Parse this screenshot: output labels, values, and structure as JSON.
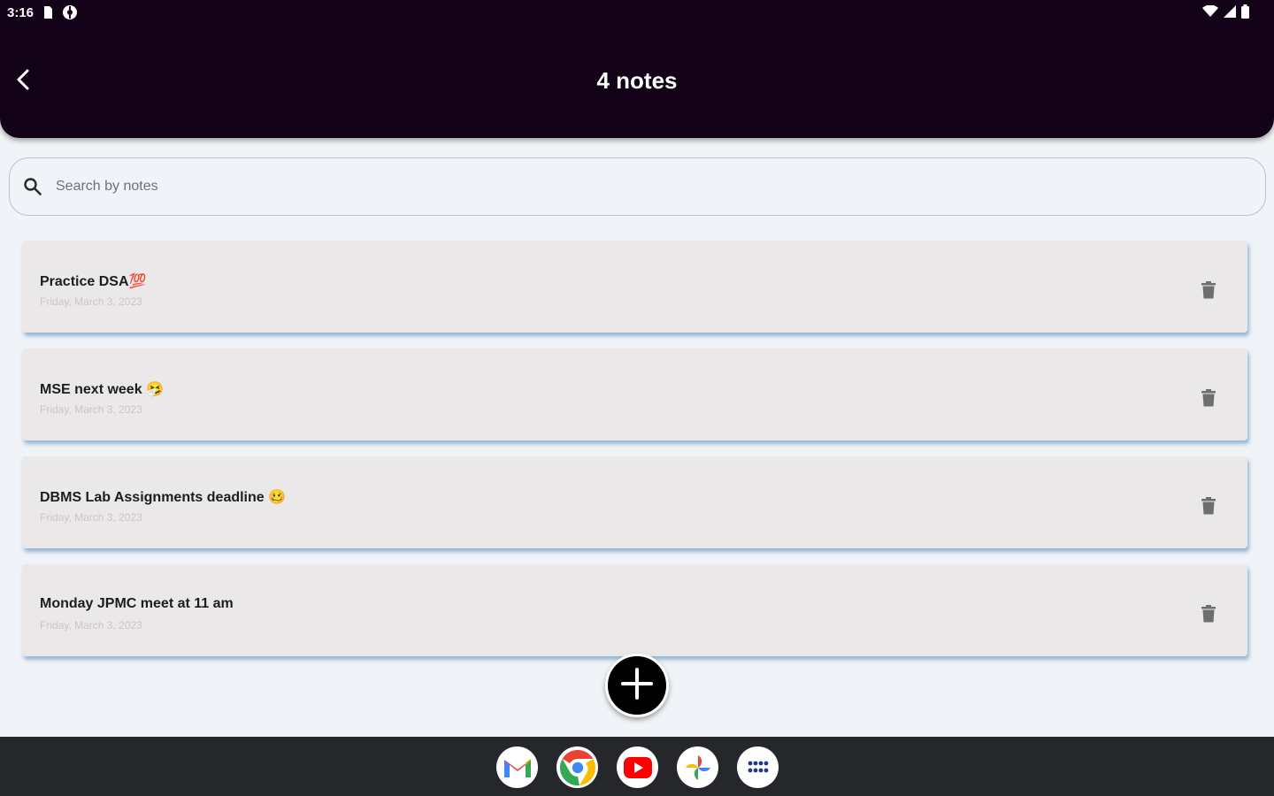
{
  "status_bar": {
    "time": "3:16",
    "left_icons": [
      "sim-card-icon",
      "settings-circle-icon"
    ],
    "right_icons": [
      "wifi-icon",
      "signal-icon",
      "battery-icon"
    ]
  },
  "app_bar": {
    "title": "4 notes",
    "back_icon": "back-arrow-icon"
  },
  "search": {
    "placeholder": "Search by notes",
    "value": "",
    "icon": "search-icon"
  },
  "notes": [
    {
      "title": "Practice DSA💯",
      "date": "Friday, March 3, 2023"
    },
    {
      "title": "MSE next week 🤧",
      "date": "Friday, March 3, 2023"
    },
    {
      "title": "DBMS Lab Assignments deadline 🥴",
      "date": "Friday, March 3, 2023"
    },
    {
      "title": "Monday JPMC meet at 11 am",
      "date": "Friday, March 3, 2023"
    }
  ],
  "fab": {
    "icon": "plus-icon"
  },
  "dock": {
    "apps": [
      "gmail-icon",
      "chrome-icon",
      "youtube-icon",
      "photos-icon",
      "app-drawer-icon"
    ]
  },
  "colors": {
    "app_bar": "#130217",
    "background": "#f0f3f7",
    "card": "#ebe8e9",
    "card_shadow": "#78a0c8",
    "dock": "#25272b"
  }
}
